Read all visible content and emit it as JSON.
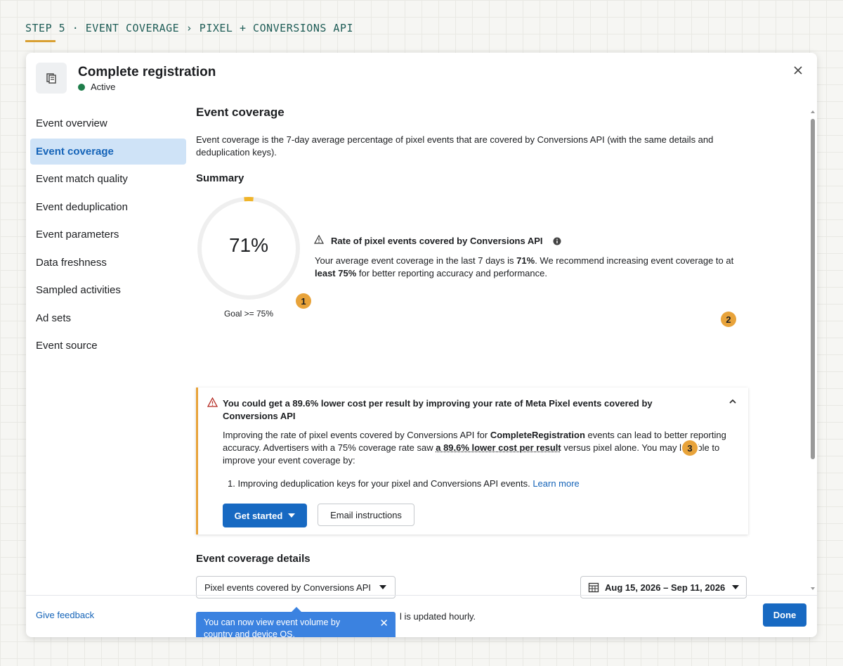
{
  "step_label": "STEP 5 · EVENT COVERAGE › PIXEL + CONVERSIONS API",
  "header": {
    "title": "Complete registration",
    "status": "Active"
  },
  "sidebar": {
    "items": [
      {
        "label": "Event overview"
      },
      {
        "label": "Event coverage",
        "active": true
      },
      {
        "label": "Event match quality"
      },
      {
        "label": "Event deduplication"
      },
      {
        "label": "Event parameters"
      },
      {
        "label": "Data freshness"
      },
      {
        "label": "Sampled activities"
      },
      {
        "label": "Ad sets"
      },
      {
        "label": "Event source"
      }
    ]
  },
  "main": {
    "title": "Event coverage",
    "intro": "Event coverage is the 7-day average percentage of pixel events that are covered by Conversions API (with the same details and deduplication keys).",
    "summary_heading": "Summary",
    "gauge": {
      "value": "71%",
      "fraction": 0.71,
      "goal": "Goal >= 75%"
    },
    "rate": {
      "title": "Rate of pixel events covered by Conversions API",
      "desc_1": "Your average event coverage in the last 7 days is ",
      "desc_value": "71%",
      "desc_2": ". We recommend increasing event coverage to at ",
      "desc_bold": "least 75%",
      "desc_3": " for better reporting accuracy and performance."
    },
    "callouts": [
      "1",
      "2",
      "3"
    ],
    "tip": {
      "title": "You could get a 89.6% lower cost per result by improving your rate of Meta Pixel events covered by Conversions API",
      "body_1": "Improving the rate of pixel events covered by Conversions API for ",
      "body_event": "CompleteRegistration",
      "body_2": " events can lead to better reporting accuracy. Advertisers with a 75% coverage rate saw ",
      "body_link": "a 89.6% lower cost per result",
      "body_3": " versus pixel alone. You may be able to improve your event coverage by:",
      "list_item": "1.  Improving deduplication keys for your pixel and Conversions API events.",
      "learn_more": "Learn more",
      "get_started": "Get started",
      "email_instructions": "Email instructions"
    },
    "details_heading": "Event coverage details",
    "metric_select": "Pixel events covered by Conversions API",
    "date_range": "Aug 15, 2026 – Sep 11, 2026",
    "updated_text": "l is updated hourly.",
    "tooltip": "You can now view event volume by country and device OS."
  },
  "footer": {
    "feedback": "Give feedback",
    "done": "Done"
  },
  "colors": {
    "accent": "#1769c2",
    "warning": "#e8a33a",
    "active": "#1e7d4a",
    "gauge_track": "#efefef",
    "gauge_fill": "#f0b429"
  }
}
